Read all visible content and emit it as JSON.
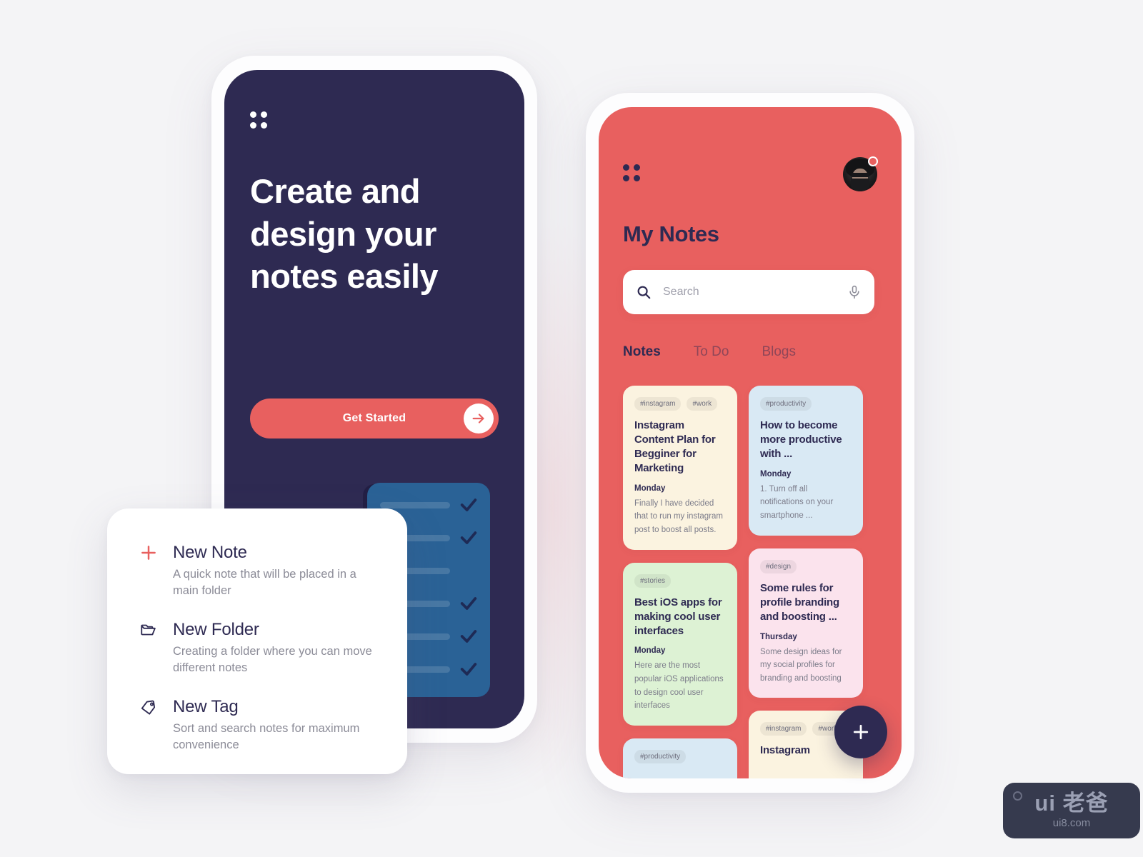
{
  "onboarding": {
    "menu_icon": "grid-icon",
    "headline": "Create and design your notes easily",
    "cta_label": "Get Started",
    "cta_arrow_icon": "arrow-right-icon",
    "checklist_card": {
      "rows": [
        {
          "icon": "check-icon",
          "checked": true
        },
        {
          "icon": "check-icon",
          "checked": true
        },
        {
          "icon": "check-icon",
          "checked": false
        },
        {
          "icon": "check-icon",
          "checked": true
        },
        {
          "icon": "check-icon",
          "checked": true
        },
        {
          "icon": "check-icon",
          "checked": true
        }
      ]
    }
  },
  "popup": {
    "items": [
      {
        "icon": "plus-icon",
        "title": "New Note",
        "desc": "A quick note that will be placed in a main folder"
      },
      {
        "icon": "folder-icon",
        "title": "New Folder",
        "desc": "Creating a folder where you can move different notes"
      },
      {
        "icon": "tag-icon",
        "title": "New Tag",
        "desc": "Sort and search notes for maximum convenience"
      }
    ]
  },
  "notes_app": {
    "menu_icon": "grid-icon",
    "avatar_name": "user-avatar",
    "avatar_badge": "notification-badge",
    "title": "My Notes",
    "search": {
      "icon": "search-icon",
      "value": "",
      "placeholder": "Search",
      "mic_icon": "microphone-icon"
    },
    "tabs": [
      {
        "label": "Notes",
        "active": true
      },
      {
        "label": "To Do",
        "active": false
      },
      {
        "label": "Blogs",
        "active": false
      }
    ],
    "cards": [
      {
        "column": 0,
        "bg": "#fbf3e0",
        "tags": [
          "#instagram",
          "#work"
        ],
        "title": "Instagram Content Plan for Begginer for Marketing",
        "day": "Monday",
        "body": "Finally I have decided that to run my instagram post to boost all posts."
      },
      {
        "column": 1,
        "bg": "#d9e9f4",
        "tags": [
          "#productivity"
        ],
        "title": "How to become more productive with ...",
        "day": "Monday",
        "body": "1. Turn off all notifications on your smartphone ..."
      },
      {
        "column": 0,
        "bg": "#ddf2d4",
        "tags": [
          "#stories"
        ],
        "title": "Best iOS apps for making cool user interfaces",
        "day": "Monday",
        "body": "Here are the most popular iOS applications to design cool user interfaces"
      },
      {
        "column": 1,
        "bg": "#fbe3ed",
        "tags": [
          "#design"
        ],
        "title": "Some rules for profile branding and boosting ...",
        "day": "Thursday",
        "body": "Some design ideas for my social profiles for branding and boosting"
      },
      {
        "column": 0,
        "bg": "#d9e9f4",
        "tags": [
          "#productivity"
        ],
        "title": "",
        "day": "",
        "body": ""
      },
      {
        "column": 1,
        "bg": "#fbf3e0",
        "tags": [
          "#instagram",
          "#work"
        ],
        "title": "Instagram",
        "day": "",
        "body": ""
      }
    ],
    "fab_icon": "plus-icon"
  },
  "watermark": {
    "main": "ui 老爸",
    "sub": "ui8.com",
    "dot_icon": "circle-dot-icon"
  },
  "colors": {
    "navy": "#2e2a52",
    "coral": "#e8605f",
    "blue_card": "#2a6296",
    "page_bg": "#f4f4f6",
    "frame": "#fdfdfe"
  }
}
